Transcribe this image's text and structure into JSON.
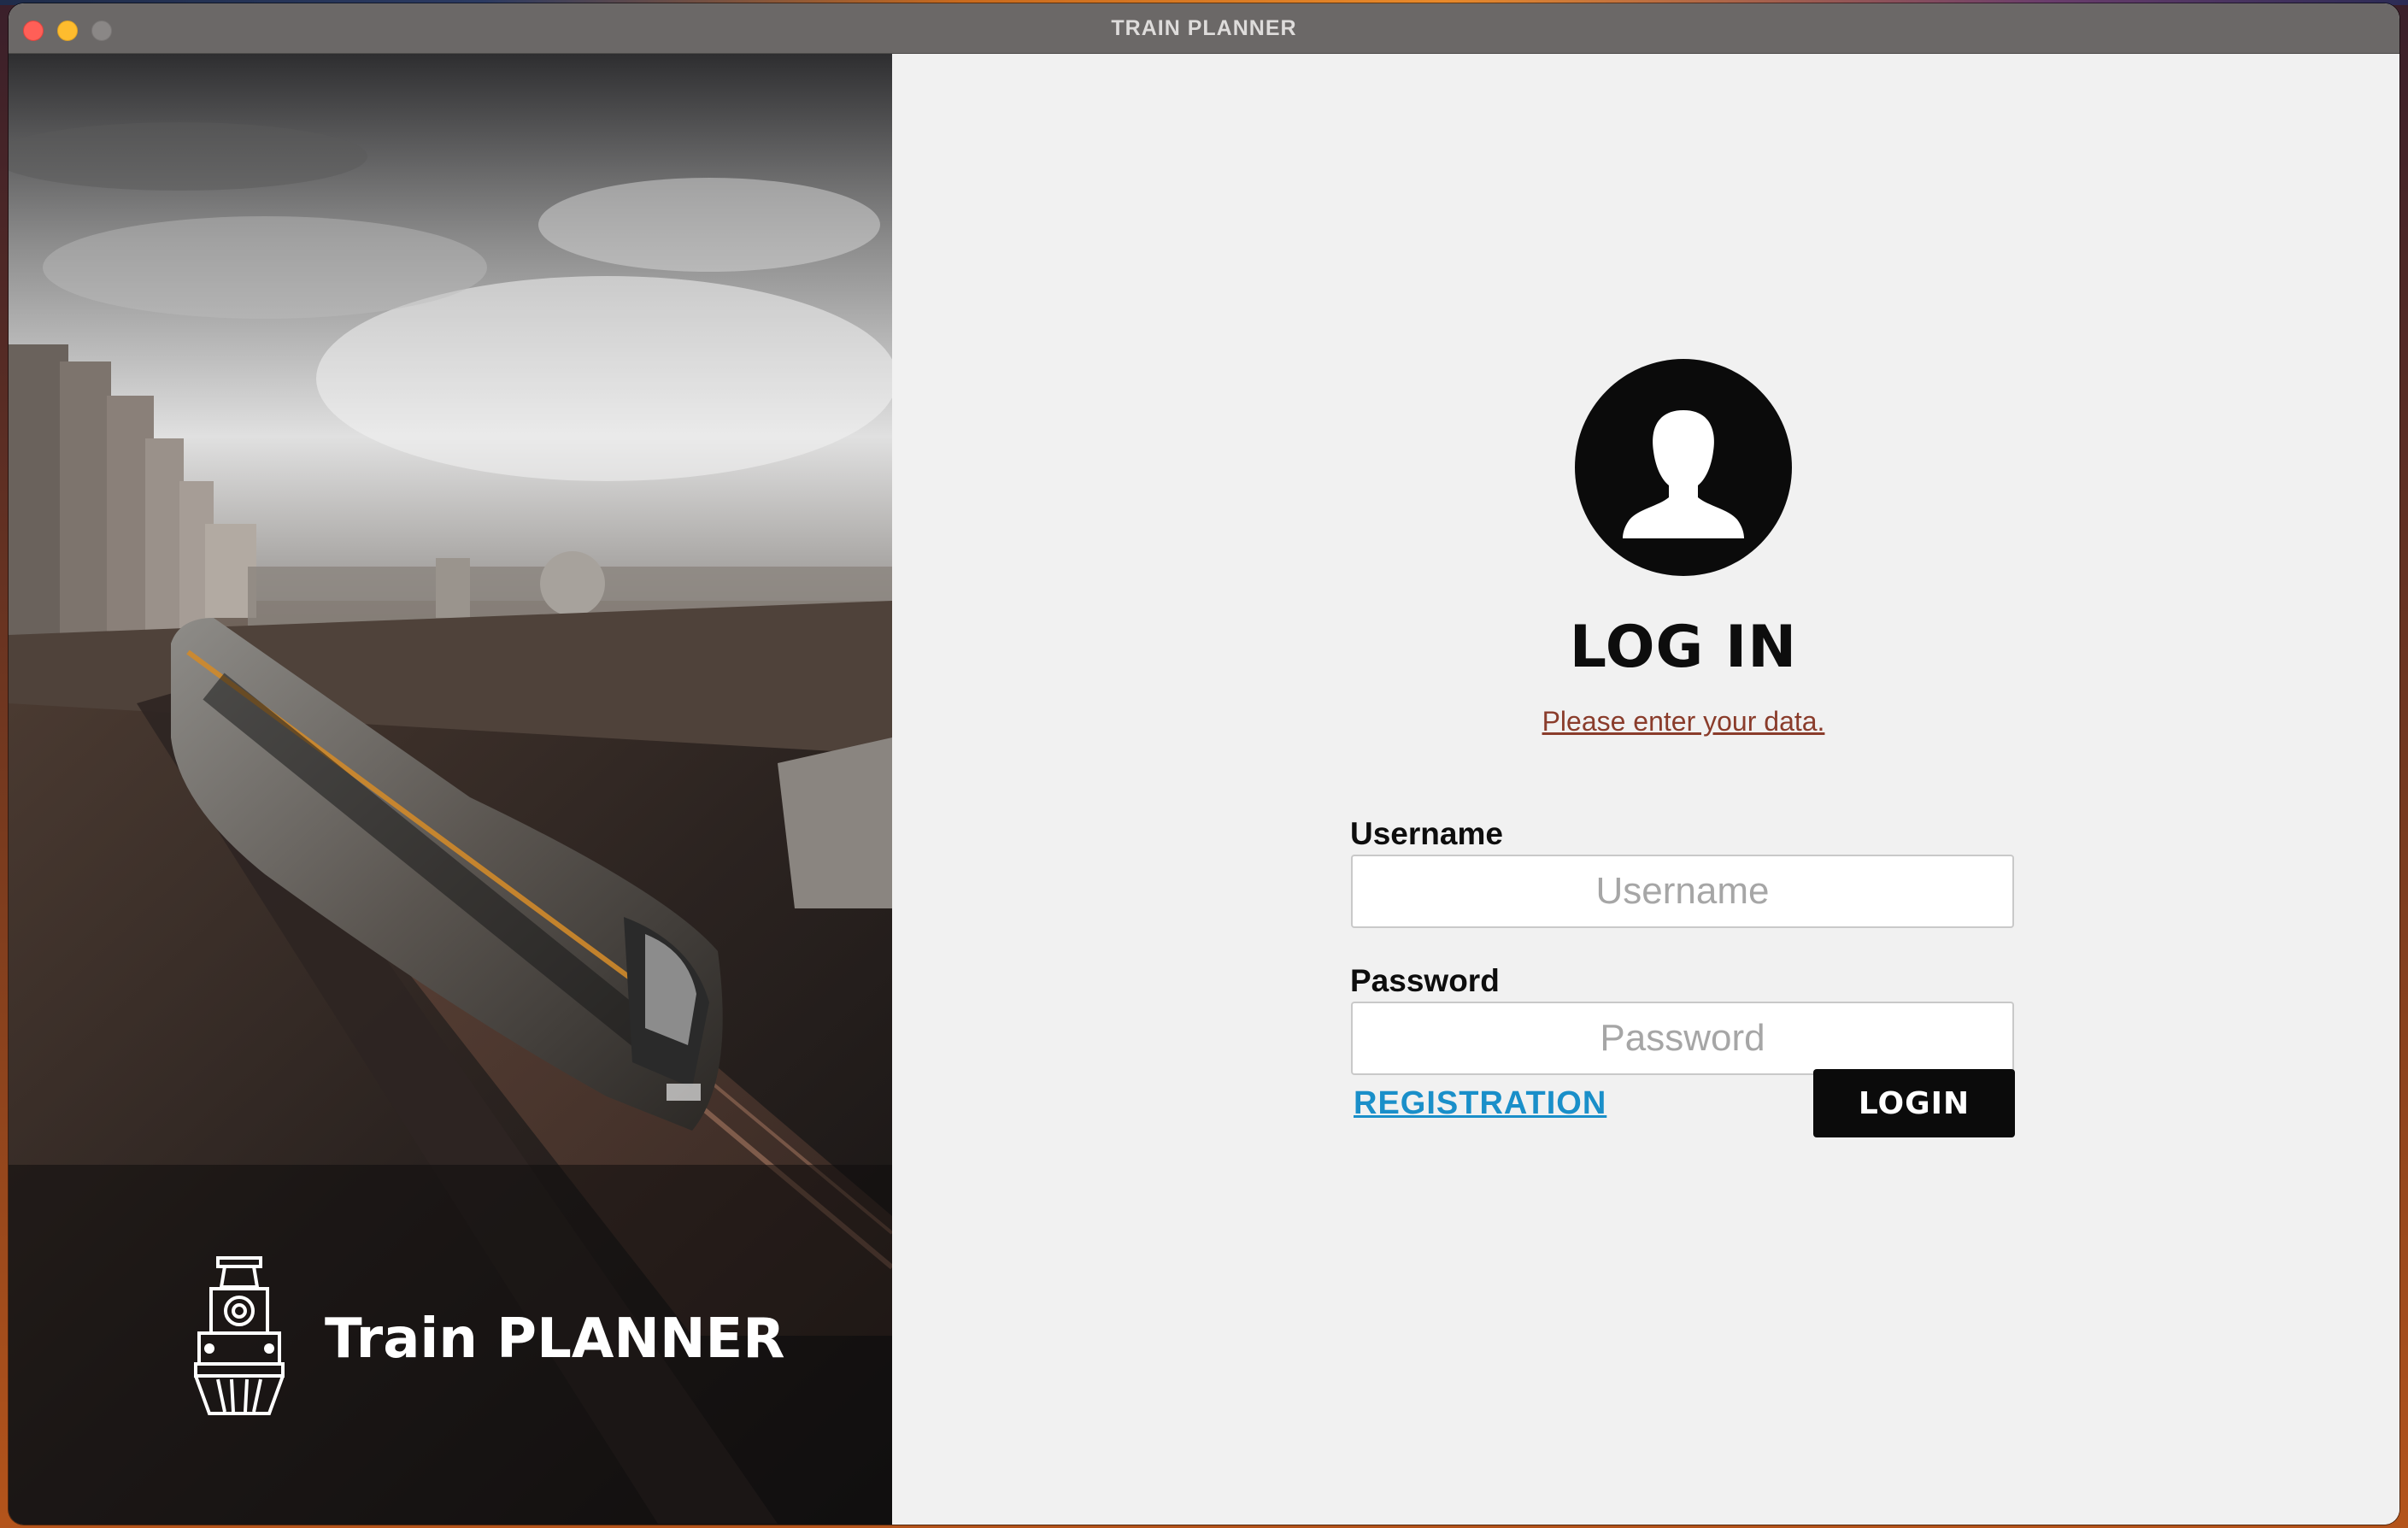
{
  "window": {
    "title": "TRAIN PLANNER",
    "controls": [
      "close",
      "minimize",
      "maximize"
    ]
  },
  "hero": {
    "brand_name": "Train PLANNER",
    "brand_icon": "locomotive-icon",
    "photo": "elevated-train-photo"
  },
  "login": {
    "avatar_icon": "user-avatar-icon",
    "title": "LOG IN",
    "subtitle": "Please enter your data.",
    "username_label": "Username",
    "username_placeholder": "Username",
    "username_value": "",
    "password_label": "Password",
    "password_placeholder": "Password",
    "password_value": "",
    "registration_link": "REGISTRATION",
    "login_button": "LOGIN"
  },
  "colors": {
    "titlebar": "#6b6867",
    "panel_bg": "#f1f1f1",
    "subtitle": "#8a3c2b",
    "link": "#1a8fc9",
    "button": "#0b0b0b"
  }
}
